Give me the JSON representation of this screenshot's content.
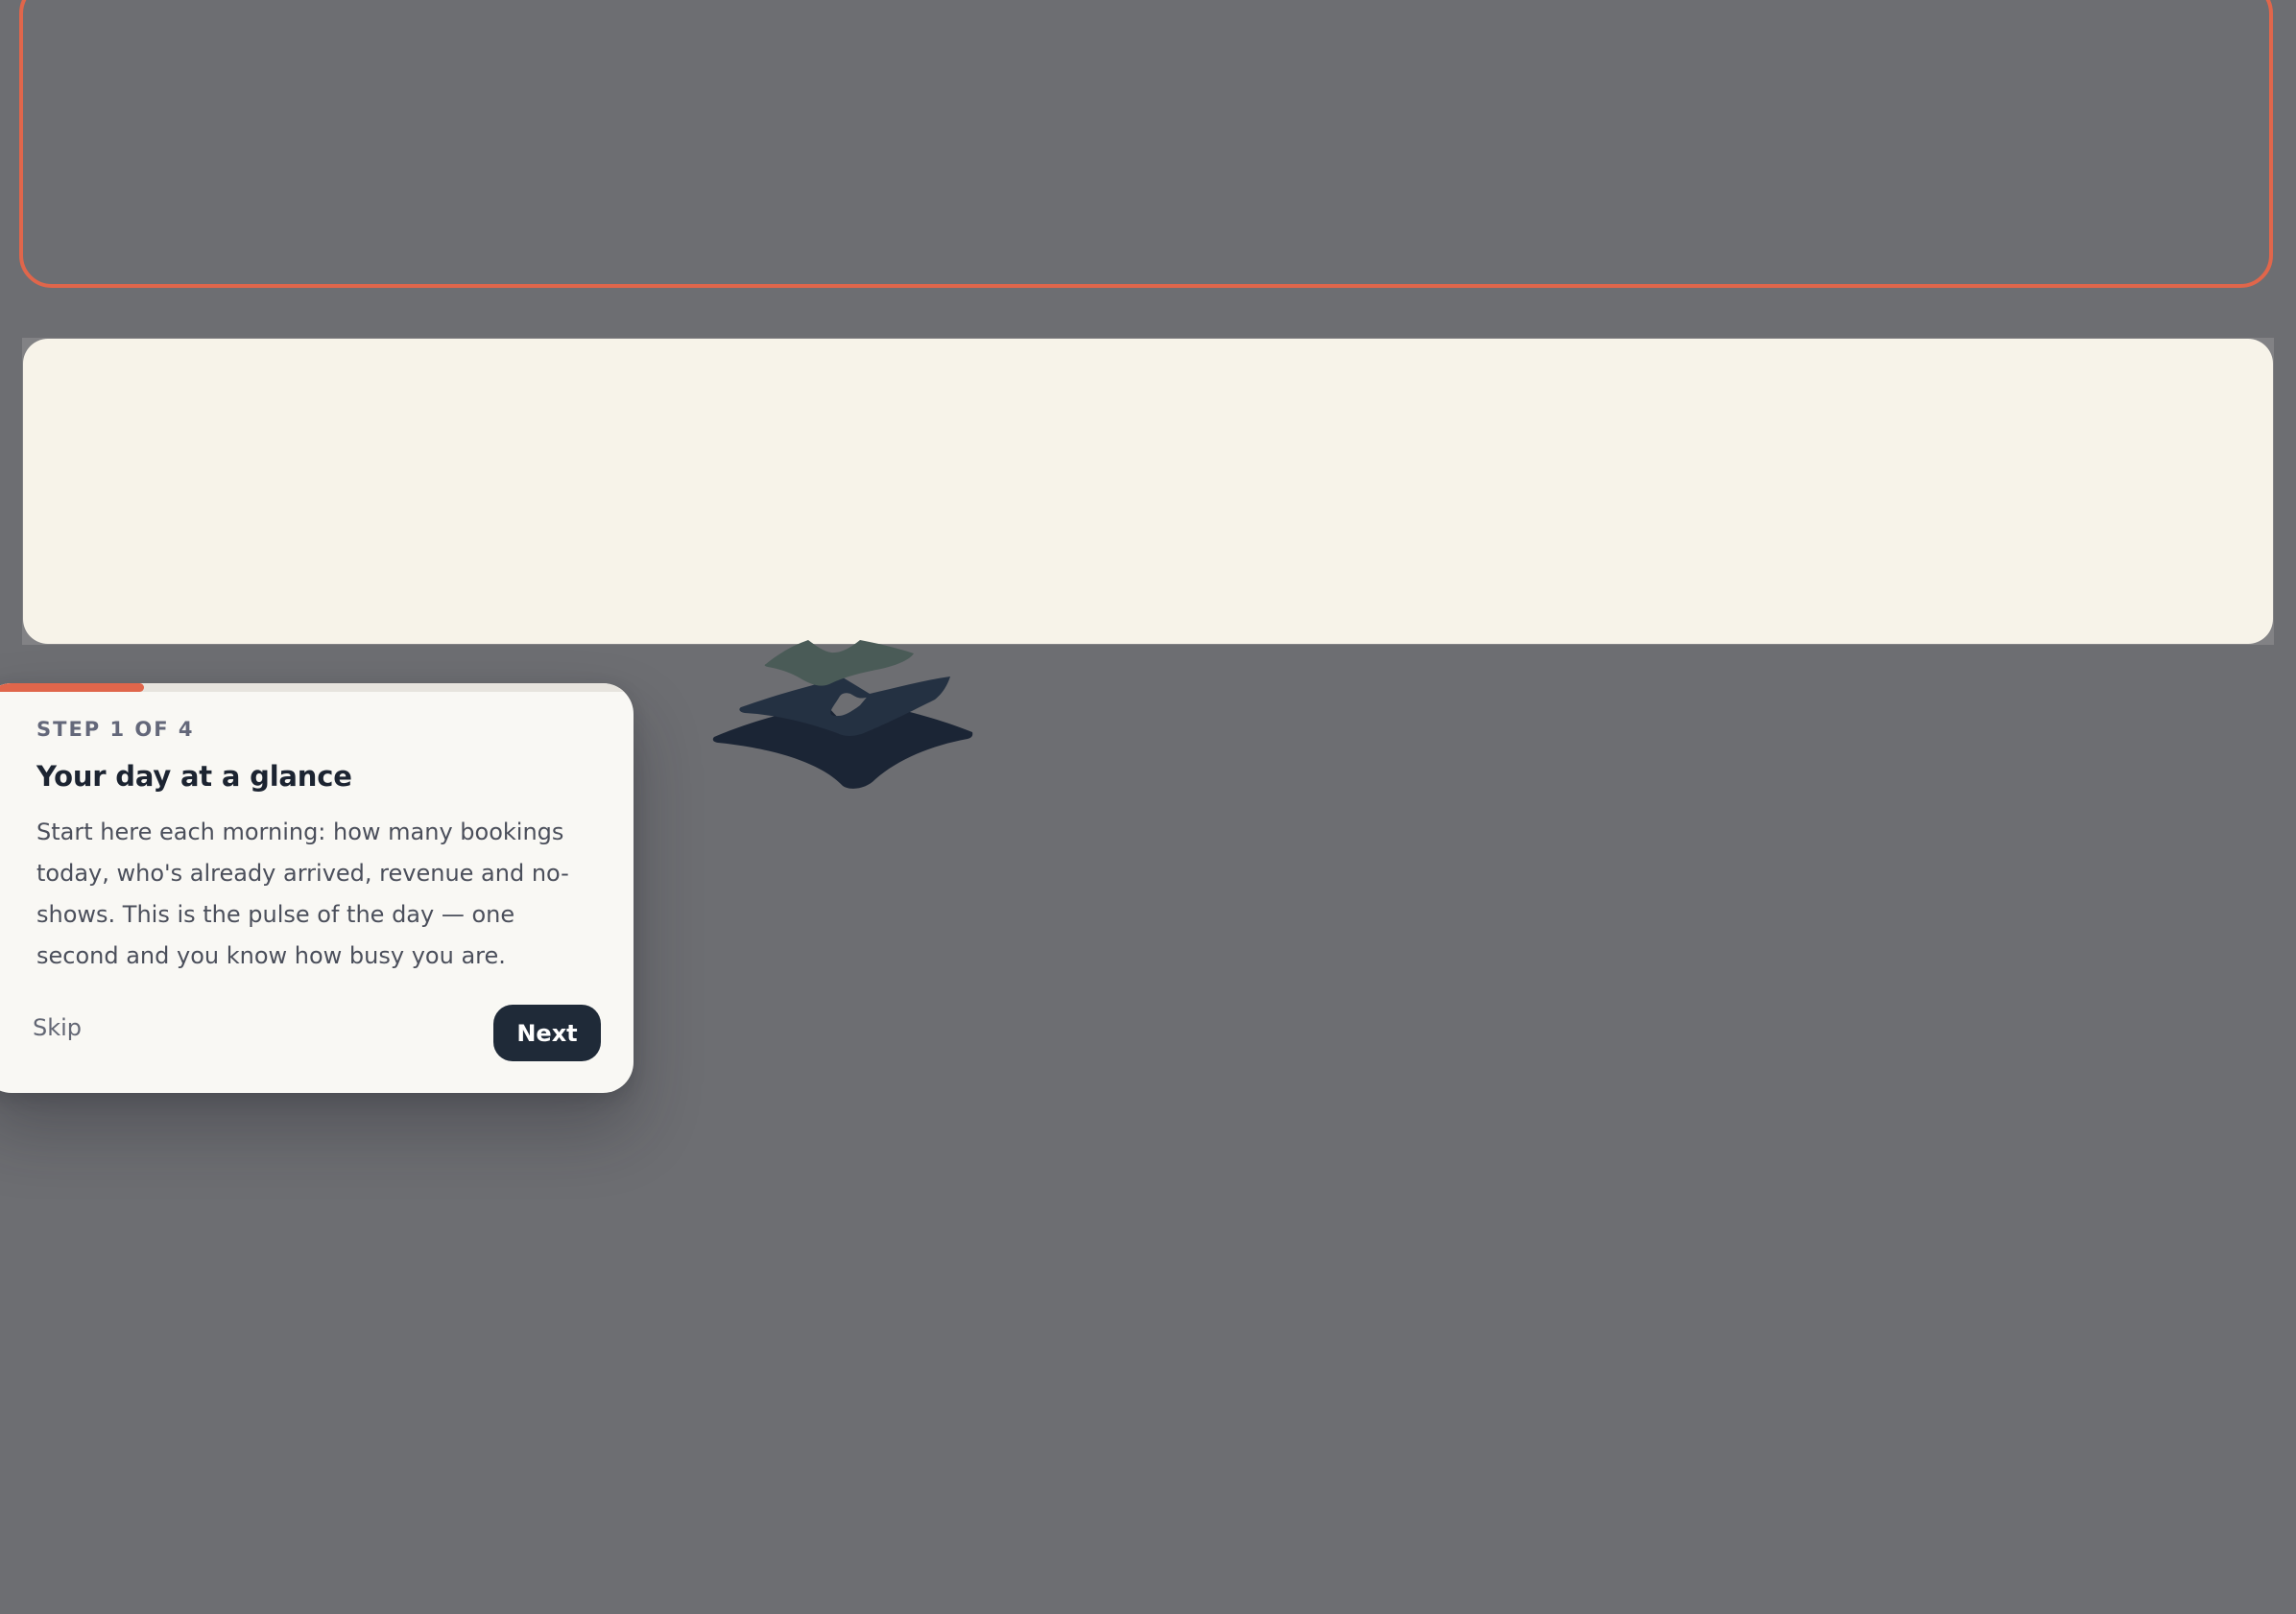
{
  "tour": {
    "step_label": "STEP 1 OF 4",
    "title": "Your day at a glance",
    "body": "Start here each morning: how many bookings today, who's already arrived, revenue and no-shows. This is the pulse of the day — one second and you know how busy you are.",
    "progress": 0.25,
    "skip_label": "Skip",
    "next_label": "Next"
  },
  "icons": {
    "illustration": "layers-stack-icon"
  },
  "colors": {
    "accent": "#e0664b",
    "primary_dark": "#1f2a38",
    "overlay": "#6d6e72",
    "card_cream": "#f7f3e9",
    "popover_bg": "#f9f8f4"
  }
}
